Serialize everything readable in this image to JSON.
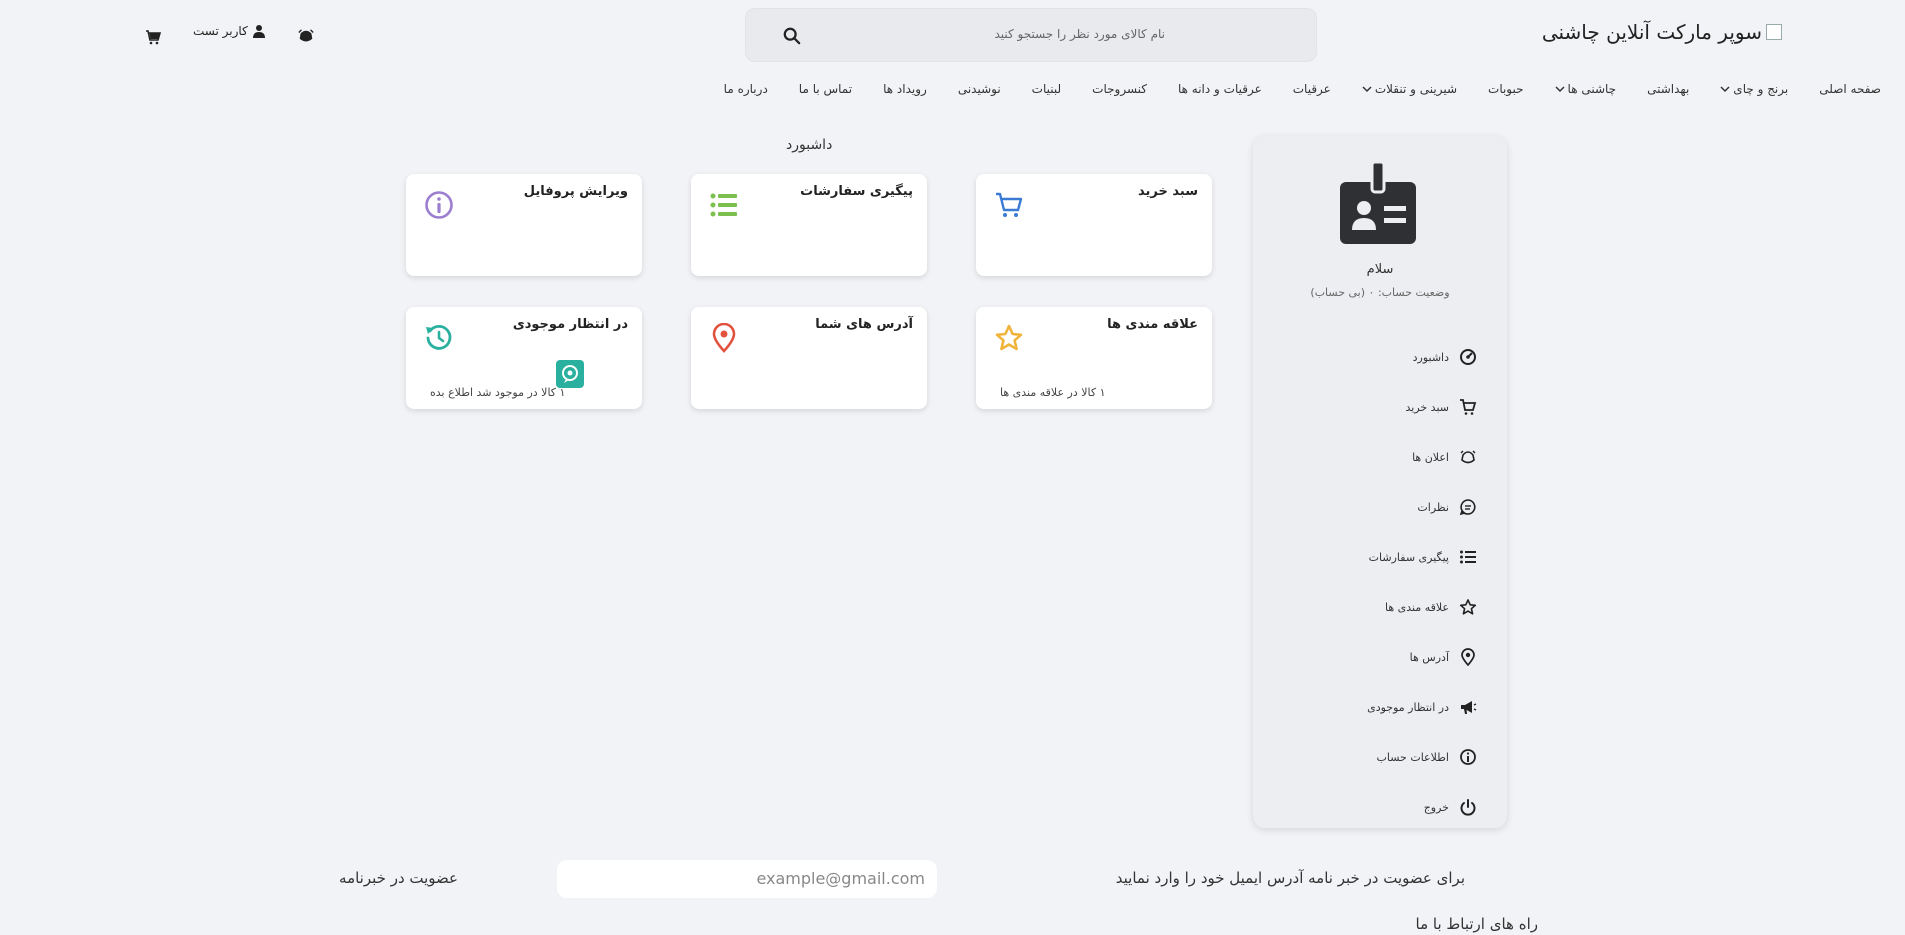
{
  "header": {
    "logo_text": "سوپر مارکت آنلاین چاشنی",
    "search_placeholder": "نام کالای مورد نظر را جستجو کنید",
    "user_label": "کاربر تست"
  },
  "nav": {
    "items": [
      {
        "label": "صفحه اصلی",
        "dropdown": false
      },
      {
        "label": "برنج و چای",
        "dropdown": true
      },
      {
        "label": "بهداشتی",
        "dropdown": false
      },
      {
        "label": "چاشنی ها",
        "dropdown": true
      },
      {
        "label": "حبوبات",
        "dropdown": false
      },
      {
        "label": "شیرینی و تنقلات",
        "dropdown": true
      },
      {
        "label": "عرقیات",
        "dropdown": false
      },
      {
        "label": "عرقیات و دانه ها",
        "dropdown": false
      },
      {
        "label": "کنسروجات",
        "dropdown": false
      },
      {
        "label": "لبنیات",
        "dropdown": false
      },
      {
        "label": "نوشیدنی",
        "dropdown": false
      },
      {
        "label": "رویداد ها",
        "dropdown": false
      },
      {
        "label": "تماس با ما",
        "dropdown": false
      },
      {
        "label": "درباره ما",
        "dropdown": false
      }
    ]
  },
  "sidebar": {
    "greeting": "سلام",
    "account_status": "وضعیت حساب: ۰ (بی حساب)",
    "menu": [
      {
        "label": "داشبورد",
        "icon": "dashboard-icon"
      },
      {
        "label": "سبد خرید",
        "icon": "cart-icon"
      },
      {
        "label": "اعلان ها",
        "icon": "notification-icon"
      },
      {
        "label": "نظرات",
        "icon": "comment-icon"
      },
      {
        "label": "پیگیری سفارشات",
        "icon": "list-icon"
      },
      {
        "label": "علاقه مندی ها",
        "icon": "star-icon"
      },
      {
        "label": "آدرس ها",
        "icon": "location-icon"
      },
      {
        "label": "در انتظار موجودی",
        "icon": "megaphone-icon"
      },
      {
        "label": "اطلاعات حساب",
        "icon": "info-icon"
      },
      {
        "label": "خروج",
        "icon": "power-icon"
      }
    ]
  },
  "dashboard": {
    "title": "داشبورد",
    "cards": {
      "cart": {
        "title": "سبد خرید",
        "subtitle": "",
        "color": "#3b7bd4"
      },
      "orders": {
        "title": "پیگیری سفارشات",
        "subtitle": "",
        "color": "#7cc04f"
      },
      "profile": {
        "title": "ویرایش پروفایل",
        "subtitle": "",
        "color": "#9b7ed0"
      },
      "favorites": {
        "title": "علاقه مندی ها",
        "subtitle": "۱ کالا در علاقه مندی ها",
        "color": "#f0b43c"
      },
      "addresses": {
        "title": "آدرس های شما",
        "subtitle": "",
        "color": "#e2533f"
      },
      "waiting": {
        "title": "در انتظار موجودی",
        "subtitle": "۱ کالا در موجود شد اطلاع بده",
        "color": "#2ab09e"
      }
    }
  },
  "footer": {
    "newsletter_title": "عضویت در خبرنامه",
    "email_placeholder": "example@gmail.com",
    "newsletter_desc": "برای عضویت در خبر نامه آدرس ایمیل خود را وارد نمایید",
    "contact_title": "راه های ارتباط با ما"
  }
}
